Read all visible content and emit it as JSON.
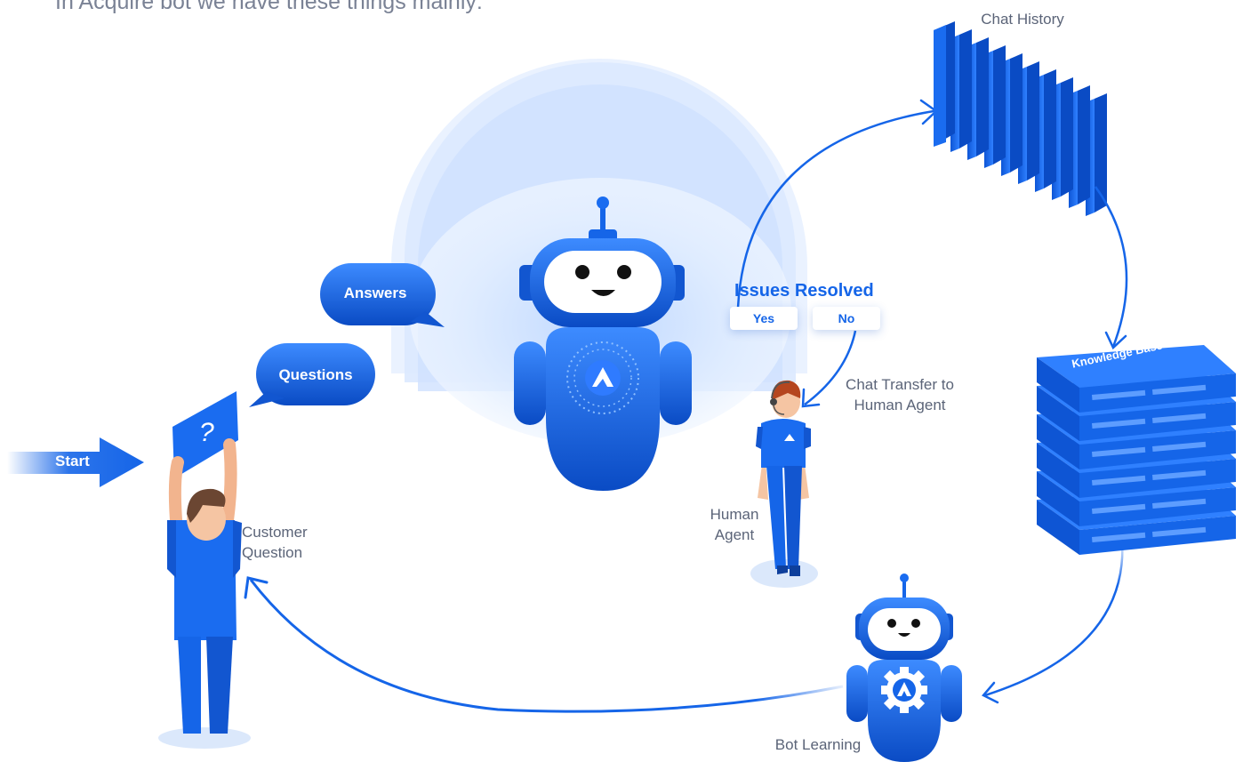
{
  "intro_text": "In Acquire bot we have these things mainly:",
  "labels": {
    "chat_history": "Chat History",
    "knowledge_base": "Knowledge Base",
    "bot_learning": "Bot Learning",
    "customer_question": [
      "Customer",
      "Question"
    ],
    "human_agent": [
      "Human",
      "Agent"
    ],
    "chat_transfer": [
      "Chat Transfer to",
      "Human Agent"
    ],
    "issues_resolved": "Issues Resolved",
    "yes": "Yes",
    "no": "No",
    "answers": "Answers",
    "questions": "Questions",
    "start": "Start",
    "question_mark": "?"
  },
  "colors": {
    "primary": "#1565e8",
    "light": "#3d8bff",
    "dark": "#0a4bc4",
    "text": "#5b6478"
  },
  "icons": [
    "robot-icon",
    "gear-icon",
    "logo-icon",
    "headset-icon"
  ]
}
